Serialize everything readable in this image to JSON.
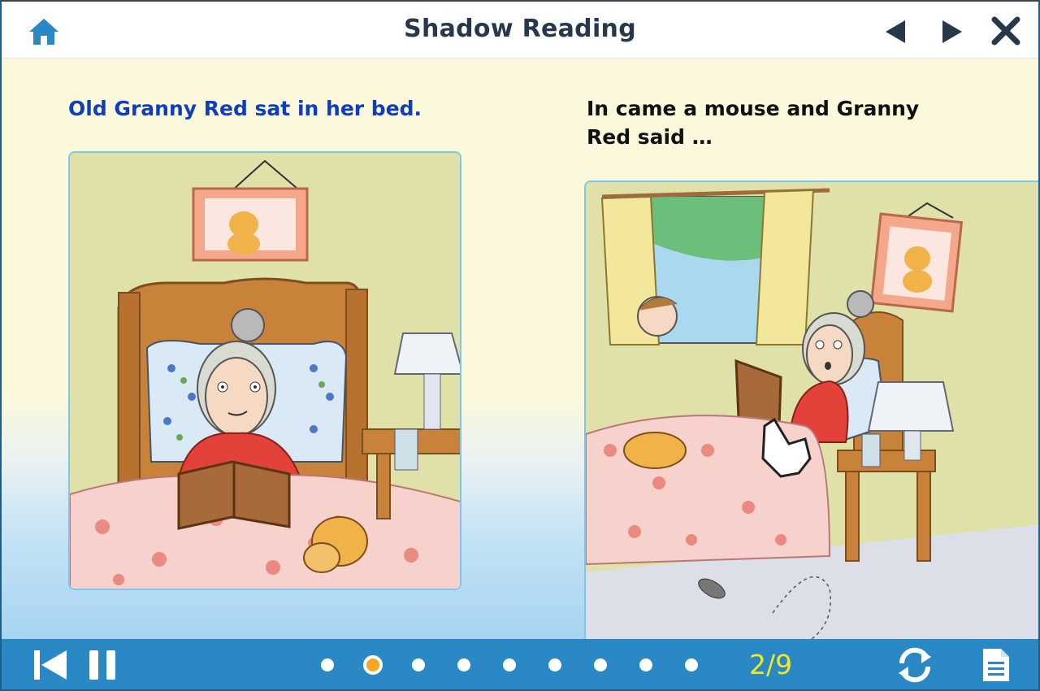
{
  "header": {
    "title": "Shadow Reading",
    "home_icon": "home-icon",
    "prev_icon": "triangle-left-icon",
    "next_icon": "triangle-right-icon",
    "close_icon": "close-icon"
  },
  "left_page": {
    "text": "Old Granny Red sat in her bed.",
    "text_color": "#0d3fbd"
  },
  "right_page": {
    "text_line1": "In came a mouse and Granny",
    "text_line2": "Red said …",
    "text_color": "#111111"
  },
  "player": {
    "first_icon": "skip-to-start-icon",
    "pause_icon": "pause-icon",
    "current_page": 2,
    "page_count": 9,
    "counter_text": "2/9",
    "replay_icon": "replay-icon",
    "transcript_icon": "document-icon"
  },
  "colors": {
    "accent": "#2a88c5",
    "active_dot": "#f6a623",
    "counter": "#f0e820",
    "title": "#26384a"
  }
}
